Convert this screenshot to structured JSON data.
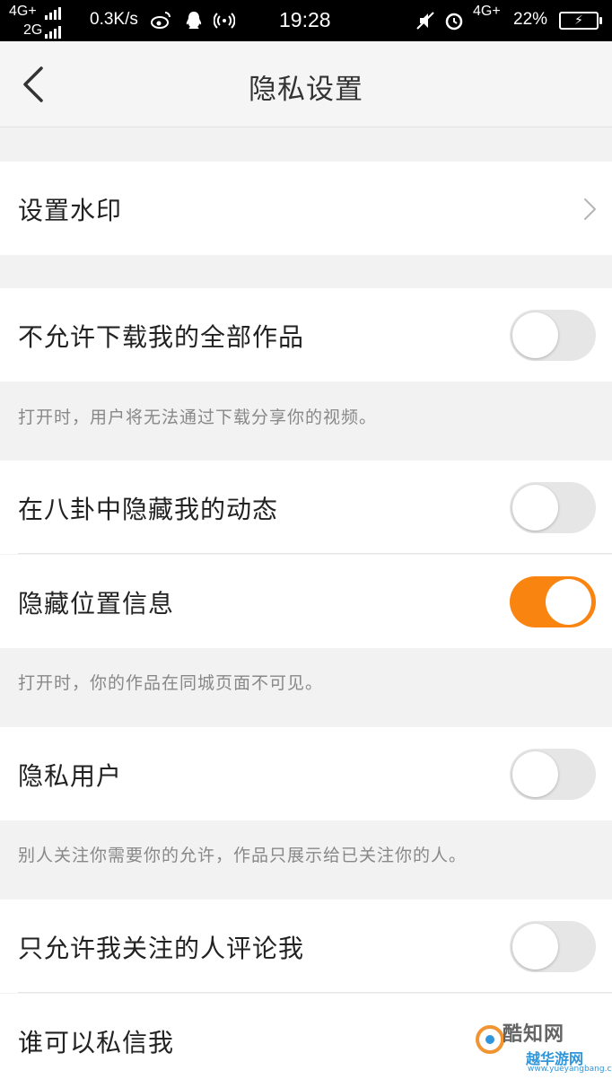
{
  "status_bar": {
    "network_line1": "4G+",
    "network_line2": "2G",
    "speed": "0.3K/s",
    "time": "19:28",
    "network_right": "4G+",
    "battery_percent": "22%",
    "icons": [
      "weibo-icon",
      "qq-icon",
      "hotspot-icon",
      "mute-icon",
      "alarm-icon",
      "battery-charging-icon"
    ]
  },
  "nav": {
    "title": "隐私设置",
    "back_icon": "chevron-left-icon"
  },
  "settings": {
    "watermark": {
      "label": "设置水印"
    },
    "no_download": {
      "label": "不允许下载我的全部作品",
      "on": false
    },
    "no_download_hint": "打开时，用户将无法通过下载分享你的视频。",
    "hide_in_gossip": {
      "label": "在八卦中隐藏我的动态",
      "on": false
    },
    "hide_location": {
      "label": "隐藏位置信息",
      "on": true
    },
    "hide_location_hint": "打开时，你的作品在同城页面不可见。",
    "private_user": {
      "label": "隐私用户",
      "on": false
    },
    "private_user_hint": "别人关注你需要你的允许，作品只展示给已关注你的人。",
    "only_following_comment": {
      "label": "只允许我关注的人评论我",
      "on": false
    },
    "who_can_message": {
      "label": "谁可以私信我"
    }
  },
  "watermark_overlay": {
    "text1": "酷知网",
    "text2": "越华游网",
    "url": "www.yueyangbang.com"
  },
  "colors": {
    "accent": "#fa8410",
    "toggle_off": "#e6e6e6",
    "background": "#f2f2f2",
    "hint_text": "#888888"
  }
}
